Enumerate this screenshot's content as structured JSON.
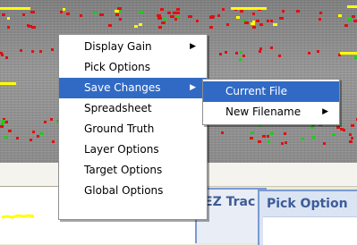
{
  "context_menu": {
    "items": [
      {
        "label": "Display Gain",
        "submenu": true,
        "highlighted": false
      },
      {
        "label": "Pick Options",
        "submenu": false,
        "highlighted": false
      },
      {
        "label": "Save Changes",
        "submenu": true,
        "highlighted": true
      },
      {
        "label": "Spreadsheet",
        "submenu": false,
        "highlighted": false
      },
      {
        "label": "Ground Truth",
        "submenu": false,
        "highlighted": false
      },
      {
        "label": "Layer Options",
        "submenu": false,
        "highlighted": false
      },
      {
        "label": "Target Options",
        "submenu": false,
        "highlighted": false
      },
      {
        "label": "Global Options",
        "submenu": false,
        "highlighted": false
      }
    ],
    "arrow_glyph": "▶"
  },
  "submenu_save_changes": {
    "items": [
      {
        "label": "Current File",
        "submenu": false,
        "highlighted": true
      },
      {
        "label": "New Filename",
        "submenu": true,
        "highlighted": false
      }
    ]
  },
  "tabs": [
    {
      "label": "EZ Trac"
    },
    {
      "label": "Pick Option"
    }
  ],
  "colors": {
    "highlight": "#316ac5",
    "pick_red": "#e01010",
    "pick_green": "#18d018",
    "pick_yellow": "#ffff00"
  }
}
